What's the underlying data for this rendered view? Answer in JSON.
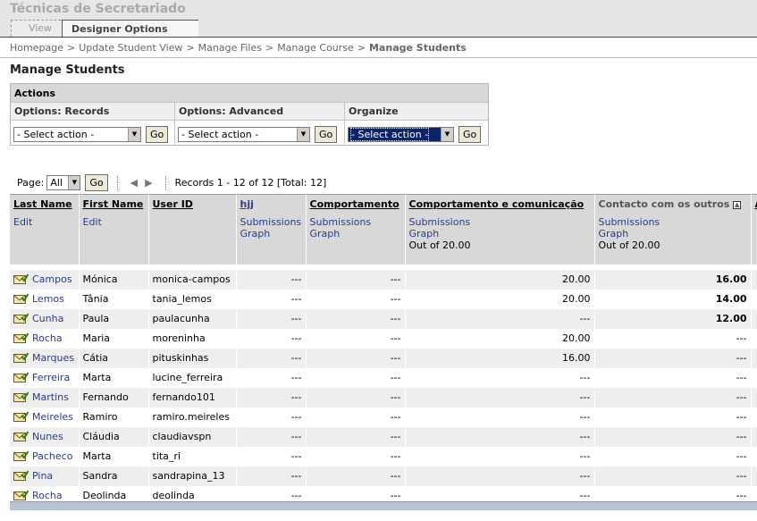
{
  "course": {
    "title": "Técnicas de Secretariado"
  },
  "tabs": {
    "view": "View",
    "designer": "Designer Options"
  },
  "breadcrumb": [
    "Homepage",
    "Update Student View",
    "Manage Files",
    "Manage Course",
    "Manage Students"
  ],
  "breadcrumb_sep": ">",
  "page_title": "Manage Students",
  "actions": {
    "title": "Actions",
    "records_label": "Options: Records",
    "advanced_label": "Options: Advanced",
    "organize_label": "Organize",
    "select_placeholder": "- Select action -",
    "go_label": "Go"
  },
  "paging": {
    "page_label": "Page:",
    "page_value": "All",
    "go_label": "Go",
    "prev_icon": "◀",
    "next_icon": "▶",
    "records_text": "Records 1 - 12 of 12 [Total: 12]"
  },
  "table": {
    "headers": {
      "last_name": "Last Name",
      "first_name": "First Name",
      "user_id": "User ID",
      "hjj": "hjj",
      "comportamento": "Comportamento",
      "comp_comunicacao": "Comportamento e comunicação",
      "contacto": "Contacto com os outros",
      "next": "A"
    },
    "subheaders": {
      "edit": "Edit",
      "submissions": "Submissions",
      "graph": "Graph",
      "out_of": "Out of 20.00"
    },
    "rows": [
      {
        "last": "Campos",
        "first": "Mónica",
        "uid": "monica-campos",
        "hjj": "---",
        "comp": "---",
        "cc": "20.00",
        "contacto": "16.00"
      },
      {
        "last": "Lemos",
        "first": "Tânia",
        "uid": "tania_lemos",
        "hjj": "---",
        "comp": "---",
        "cc": "20.00",
        "contacto": "14.00"
      },
      {
        "last": "Cunha",
        "first": "Paula",
        "uid": "paulacunha",
        "hjj": "---",
        "comp": "---",
        "cc": "---",
        "contacto": "12.00"
      },
      {
        "last": "Rocha",
        "first": "Maria",
        "uid": "moreninha",
        "hjj": "---",
        "comp": "---",
        "cc": "20.00",
        "contacto": "---"
      },
      {
        "last": "Marques",
        "first": "Cátia",
        "uid": "pituskinhas",
        "hjj": "---",
        "comp": "---",
        "cc": "16.00",
        "contacto": "---"
      },
      {
        "last": "Ferreira",
        "first": "Marta",
        "uid": "lucine_ferreira",
        "hjj": "---",
        "comp": "---",
        "cc": "---",
        "contacto": "---"
      },
      {
        "last": "Martins",
        "first": "Fernando",
        "uid": "fernando101",
        "hjj": "---",
        "comp": "---",
        "cc": "---",
        "contacto": "---"
      },
      {
        "last": "Meireles",
        "first": "Ramiro",
        "uid": "ramiro.meireles",
        "hjj": "---",
        "comp": "---",
        "cc": "---",
        "contacto": "---"
      },
      {
        "last": "Nunes",
        "first": "Cláudia",
        "uid": "claudiavspn",
        "hjj": "---",
        "comp": "---",
        "cc": "---",
        "contacto": "---"
      },
      {
        "last": "Pacheco",
        "first": "Marta",
        "uid": "tita_ri",
        "hjj": "---",
        "comp": "---",
        "cc": "---",
        "contacto": "---"
      },
      {
        "last": "Pina",
        "first": "Sandra",
        "uid": "sandrapina_13",
        "hjj": "---",
        "comp": "---",
        "cc": "---",
        "contacto": "---"
      },
      {
        "last": "Rocha",
        "first": "Deolinda",
        "uid": "deolinda",
        "hjj": "---",
        "comp": "---",
        "cc": "---",
        "contacto": "---"
      }
    ]
  },
  "icons": {
    "row_icon": "envelope-check-icon",
    "sort_icon": "sort-toggle-icon"
  },
  "colors": {
    "link": "#2b3a8a",
    "header_bg": "#d8d8d8",
    "row_alt": "#eeeeee"
  }
}
